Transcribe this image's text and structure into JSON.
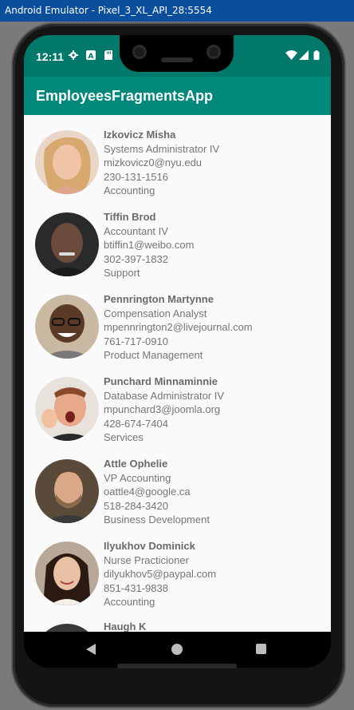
{
  "window": {
    "title": "Android Emulator - Pixel_3_XL_API_28:5554"
  },
  "status_bar": {
    "time": "12:11",
    "icons": [
      "settings-gear-icon",
      "a-badge-icon",
      "sd-card-icon",
      "wifi-icon",
      "cell-signal-icon",
      "battery-icon"
    ]
  },
  "app_bar": {
    "title": "EmployeesFragmentsApp"
  },
  "colors": {
    "status_bar": "#00796b",
    "app_bar": "#00897b",
    "list_bg": "#fafafa",
    "text": "#757575"
  },
  "employees": [
    {
      "name": "Izkovicz Misha",
      "title": "Systems Administrator IV",
      "email": "mizkovicz0@nyu.edu",
      "phone": "230-131-1516",
      "department": "Accounting",
      "avatar": "avatar-photo-woman-blonde"
    },
    {
      "name": "Tiffin Brod",
      "title": "Accountant IV",
      "email": "btiffin1@weibo.com",
      "phone": "302-397-1832",
      "department": "Support",
      "avatar": "avatar-photo-man-bald"
    },
    {
      "name": "Pennrington Martynne",
      "title": "Compensation Analyst",
      "email": "mpennrington2@livejournal.com",
      "phone": "761-717-0910",
      "department": "Product Management",
      "avatar": "avatar-photo-man-glasses"
    },
    {
      "name": "Punchard Minnaminnie",
      "title": "Database Administrator IV",
      "email": "mpunchard3@joomla.org",
      "phone": "428-674-7404",
      "department": "Services",
      "avatar": "avatar-photo-man-surprised"
    },
    {
      "name": "Attle Ophelie",
      "title": "VP Accounting",
      "email": "oattle4@google.ca",
      "phone": "518-284-3420",
      "department": "Business Development",
      "avatar": "avatar-photo-man-beard"
    },
    {
      "name": "Ilyukhov Dominick",
      "title": "Nurse Practicioner",
      "email": "dilyukhov5@paypal.com",
      "phone": "851-431-9838",
      "department": "Accounting",
      "avatar": "avatar-photo-woman-darkhair"
    }
  ],
  "partial_row": {
    "name": "Haugh K"
  },
  "nav_bar": {
    "buttons": [
      "back-icon",
      "home-icon",
      "recents-icon"
    ]
  }
}
